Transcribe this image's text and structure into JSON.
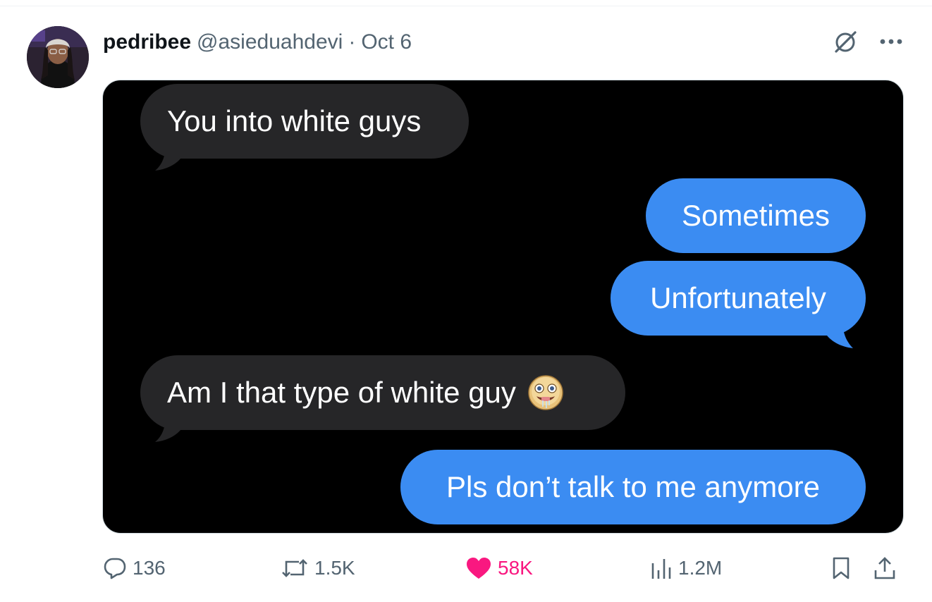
{
  "post": {
    "display_name": "pedribee",
    "handle": "@asieduahdevi",
    "separator": "·",
    "date": "Oct 6"
  },
  "header_icons": [
    "grok-icon",
    "more-icon"
  ],
  "messages": [
    {
      "direction": "incoming",
      "text": "You into white guys"
    },
    {
      "direction": "outgoing",
      "text": "Sometimes"
    },
    {
      "direction": "outgoing",
      "text": "Unfortunately"
    },
    {
      "direction": "incoming",
      "text": "Am I that type of white guy",
      "emoji": "drooling-face-emoji"
    },
    {
      "direction": "outgoing",
      "text": "Pls don’t talk to me anymore"
    }
  ],
  "actions": {
    "replies": "136",
    "reposts": "1.5K",
    "likes": "58K",
    "views": "1.2M"
  },
  "colors": {
    "outgoing_bubble": "#3b8cf2",
    "incoming_bubble": "#262628",
    "like_active": "#f91880",
    "muted_text": "#536471"
  }
}
